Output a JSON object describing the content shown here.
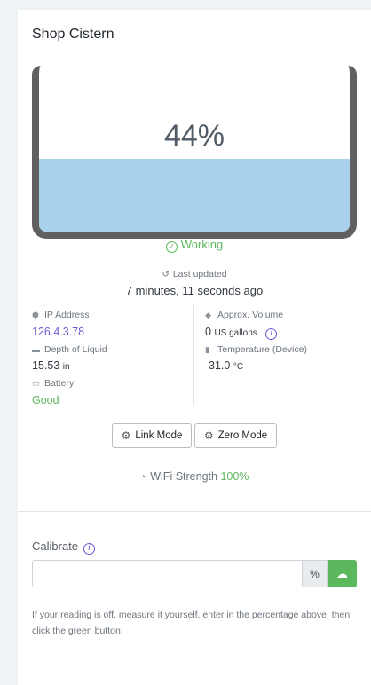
{
  "header": {
    "title": "Shop Cistern"
  },
  "tank": {
    "level_percent": 44,
    "level_label": "44%",
    "liquid_color": "#a9d1ec",
    "frame_color": "#606060"
  },
  "status": {
    "text": "Working",
    "icon": "check-circle-icon",
    "color": "#5cb85c"
  },
  "updated": {
    "label": "Last updated",
    "value": "7 minutes, 11 seconds ago",
    "icon": "history-icon"
  },
  "details": {
    "ip": {
      "label": "IP Address",
      "value": "126.4.3.78",
      "icon": "tag-icon",
      "color": "#6f5bd6"
    },
    "depth": {
      "label": "Depth of Liquid",
      "value": "15.53",
      "unit": "in",
      "icon": "ruler-icon"
    },
    "battery": {
      "label": "Battery",
      "value": "Good",
      "icon": "battery-icon",
      "color": "#5cb85c"
    },
    "volume": {
      "label": "Approx. Volume",
      "value": "0",
      "unit": "US gallons",
      "icon": "cube-icon"
    },
    "temperature": {
      "label": "Temperature (Device)",
      "value": "31.0",
      "unit": "°C",
      "icon": "thermometer-icon"
    }
  },
  "buttons": {
    "link_mode": "Link Mode",
    "zero_mode": "Zero Mode"
  },
  "wifi": {
    "label": "WiFi Strength",
    "value": "100%",
    "icon": "wifi-icon",
    "color": "#5cb85c"
  },
  "calibrate": {
    "label": "Calibrate",
    "input_value": "",
    "suffix": "%",
    "submit_icon": "cloud-upload-icon",
    "help": "If your reading is off, measure it yourself, enter in the percentage above, then click the green button."
  },
  "colors": {
    "accent": "#6f5bd6",
    "success": "#5cb85c"
  }
}
